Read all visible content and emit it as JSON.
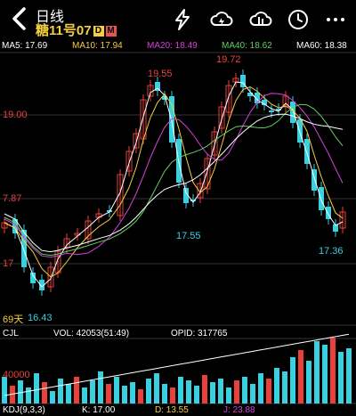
{
  "header": {
    "title": "日线",
    "subtitle": "糖11号07",
    "tag_d": "D",
    "tag_m": "M",
    "icons": [
      "back-arrow-icon",
      "flash-icon",
      "cloud-icon",
      "cloud-sync-icon",
      "clock-icon",
      "more-icon"
    ]
  },
  "ma": {
    "ma5": "MA5: 17.69",
    "ma10": "MA10: 17.94",
    "ma20": "MA20: 18.49",
    "ma40": "MA40: 18.62",
    "ma60": "MA60: 18.38"
  },
  "price_labels": {
    "high1": "19.55",
    "high2": "19.72",
    "y1": "19.00",
    "y2": "7.87",
    "y3": "17",
    "low1": "17.55",
    "low2": "17.36",
    "low3": "16.43",
    "days": "69天"
  },
  "sub_indicator": {
    "name": "CJL",
    "vol": "VOL: 42053(51:49)",
    "opid": "OPID: 317765",
    "axis": "40000"
  },
  "kdj": {
    "name": "KDJ(9,3,3)",
    "k": "K: 17.00",
    "d": "D: 13.55",
    "j": "J: 23.88"
  },
  "colors": {
    "up": "#e8413c",
    "down": "#3ad0e0",
    "ma5": "#ffffff",
    "ma10": "#f6cf3f",
    "ma20": "#d740d9",
    "ma40": "#5fd05f",
    "ma60": "#ffffff",
    "gold": "#f6cf3f"
  }
}
